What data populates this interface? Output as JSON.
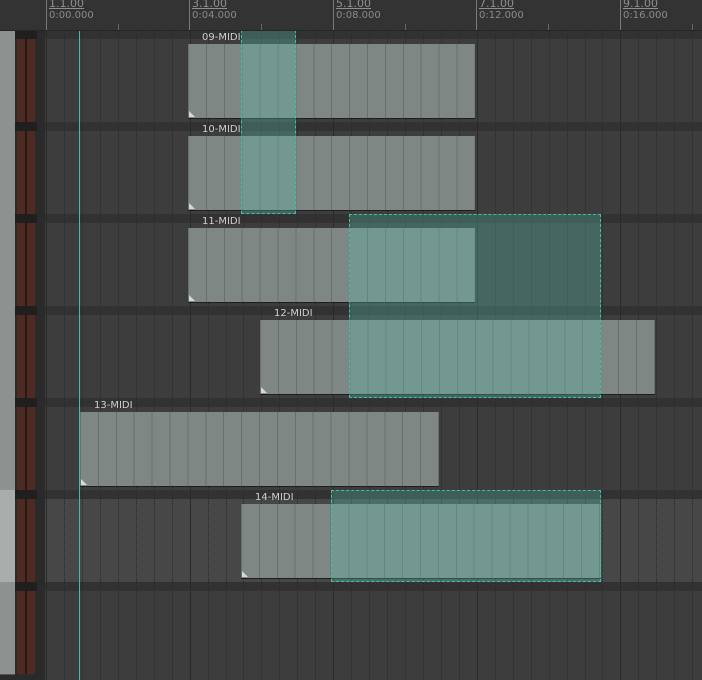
{
  "ruler": {
    "marks": [
      {
        "bar": "1.1.00",
        "time": "0:00.000"
      },
      {
        "bar": "3.1.00",
        "time": "0:04.000"
      },
      {
        "bar": "5.1.00",
        "time": "0:08.000"
      },
      {
        "bar": "7.1.00",
        "time": "0:12.000"
      },
      {
        "bar": "9.1.00",
        "time": "0:16.000"
      }
    ]
  },
  "tracks": [
    {
      "item": "09-MIDI",
      "selected": false
    },
    {
      "item": "10-MIDI",
      "selected": false
    },
    {
      "item": "11-MIDI",
      "selected": false
    },
    {
      "item": "12-MIDI",
      "selected": false
    },
    {
      "item": "13-MIDI",
      "selected": false
    },
    {
      "item": "14-MIDI",
      "selected": true
    },
    {
      "item": "",
      "selected": false
    }
  ],
  "colors": {
    "item_body": "#7f8784",
    "selection_border": "#3fbfa8",
    "meter": "#4d2a22"
  }
}
